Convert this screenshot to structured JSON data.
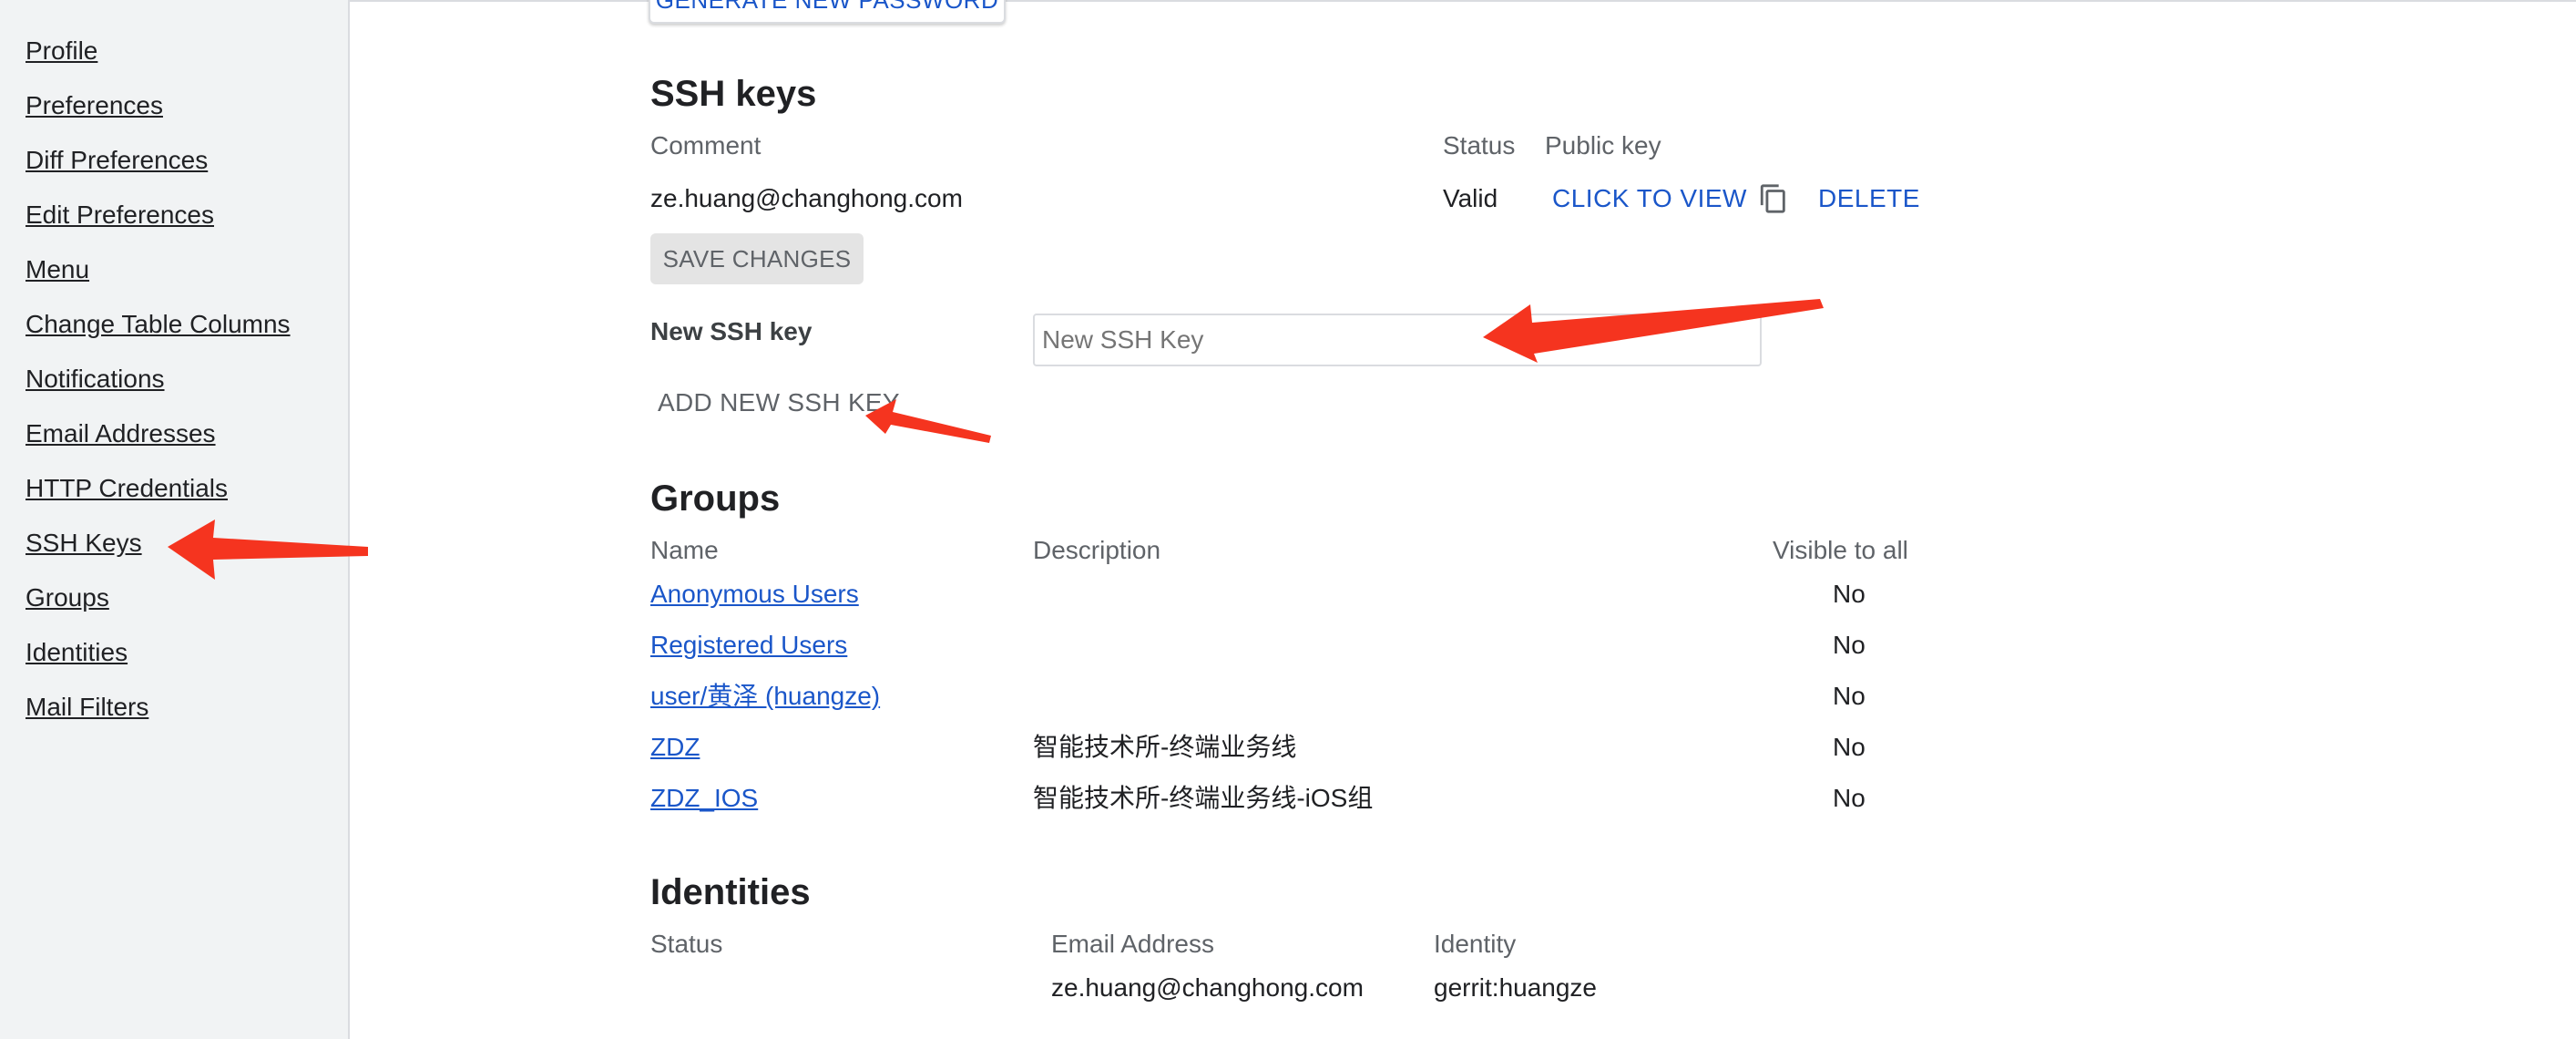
{
  "sidebar": {
    "items": [
      {
        "label": "Profile"
      },
      {
        "label": "Preferences"
      },
      {
        "label": "Diff Preferences"
      },
      {
        "label": "Edit Preferences"
      },
      {
        "label": "Menu"
      },
      {
        "label": "Change Table Columns"
      },
      {
        "label": "Notifications"
      },
      {
        "label": "Email Addresses"
      },
      {
        "label": "HTTP Credentials"
      },
      {
        "label": "SSH Keys"
      },
      {
        "label": "Groups"
      },
      {
        "label": "Identities"
      },
      {
        "label": "Mail Filters"
      }
    ]
  },
  "http_credentials": {
    "generate_button": "GENERATE NEW PASSWORD"
  },
  "ssh_keys": {
    "title": "SSH keys",
    "headers": {
      "comment": "Comment",
      "status": "Status",
      "public_key": "Public key"
    },
    "rows": [
      {
        "comment": "ze.huang@changhong.com",
        "status": "Valid",
        "view_label": "CLICK TO VIEW",
        "delete_label": "DELETE"
      }
    ],
    "save_button": "SAVE CHANGES",
    "new_key_label": "New SSH key",
    "new_key_placeholder": "New SSH Key",
    "new_key_value": "",
    "add_button": "ADD NEW SSH KEY"
  },
  "groups": {
    "title": "Groups",
    "headers": {
      "name": "Name",
      "description": "Description",
      "visible": "Visible to all"
    },
    "rows": [
      {
        "name": "Anonymous Users",
        "description": "",
        "visible": "No"
      },
      {
        "name": "Registered Users",
        "description": "",
        "visible": "No"
      },
      {
        "name": "user/黄泽 (huangze)",
        "description": "",
        "visible": "No"
      },
      {
        "name": "ZDZ",
        "description": "智能技术所-终端业务线",
        "visible": "No"
      },
      {
        "name": "ZDZ_IOS",
        "description": "智能技术所-终端业务线-iOS组",
        "visible": "No"
      }
    ]
  },
  "identities": {
    "title": "Identities",
    "headers": {
      "status": "Status",
      "email": "Email Address",
      "identity": "Identity"
    },
    "rows": [
      {
        "status": "",
        "email": "ze.huang@changhong.com",
        "identity": "gerrit:huangze"
      }
    ]
  },
  "colors": {
    "link": "#1a56c9",
    "annotation_arrow": "#f5341f",
    "sidebar_bg": "#f1f3f4"
  }
}
